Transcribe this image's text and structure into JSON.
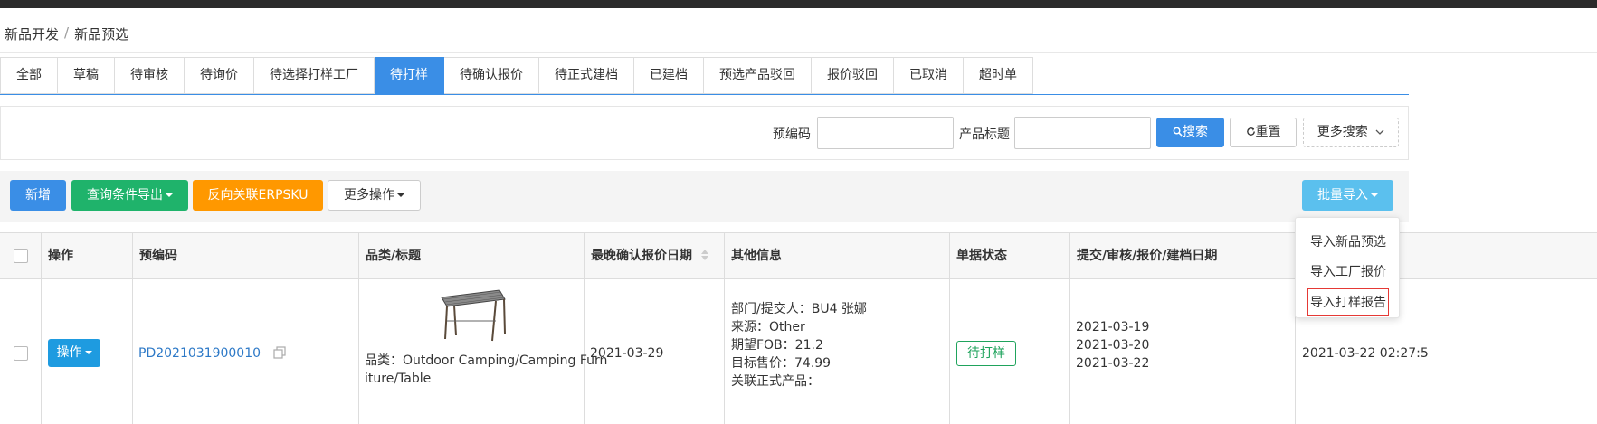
{
  "breadcrumb": {
    "root": "新品开发",
    "separator": "/",
    "current": "新品预选"
  },
  "tabs": [
    {
      "label": "全部"
    },
    {
      "label": "草稿"
    },
    {
      "label": "待审核"
    },
    {
      "label": "待询价"
    },
    {
      "label": "待选择打样工厂"
    },
    {
      "label": "待打样",
      "active": true
    },
    {
      "label": "待确认报价"
    },
    {
      "label": "待正式建档"
    },
    {
      "label": "已建档"
    },
    {
      "label": "预选产品驳回"
    },
    {
      "label": "报价驳回"
    },
    {
      "label": "已取消"
    },
    {
      "label": "超时单"
    }
  ],
  "search": {
    "code_label": "预编码",
    "code_value": "",
    "title_label": "产品标题",
    "title_value": "",
    "search_label": "搜索",
    "reset_label": "重置",
    "more_label": "更多搜索"
  },
  "actions": {
    "add": "新增",
    "export": "查询条件导出",
    "reverse": "反向关联ERPSKU",
    "more": "更多操作",
    "batch_import": "批量导入"
  },
  "batch_menu": {
    "items": [
      "导入新品预选",
      "导入工厂报价",
      "导入打样报告"
    ],
    "highlighted_index": 2
  },
  "table": {
    "headers": {
      "op": "操作",
      "code": "预编码",
      "category": "品类/标题",
      "latest_date": "最晚确认报价日期",
      "other": "其他信息",
      "status": "单据状态",
      "dates": "提交/审核/报价/建档日期"
    },
    "rows": [
      {
        "op_label": "操作",
        "code": "PD2021031900010",
        "category_line1": "品类：Outdoor Camping/Camping Furn",
        "category_line2": "iture/Table",
        "latest_date": "2021-03-29",
        "other": [
          "部门/提交人：BU4 张娜",
          "来源：Other",
          "期望FOB：21.2",
          "目标售价：74.99",
          "关联正式产品："
        ],
        "status": "待打样",
        "dates": [
          "2021-03-19",
          "2021-03-20",
          "2021-03-22"
        ],
        "extra_date": "2021-03-22 02:27:5"
      }
    ]
  },
  "colors": {
    "primary": "#3a8ee6",
    "green": "#1fb36b",
    "orange": "#ff9800",
    "light_blue": "#5bc0ee",
    "status_green": "#1fa35c"
  }
}
